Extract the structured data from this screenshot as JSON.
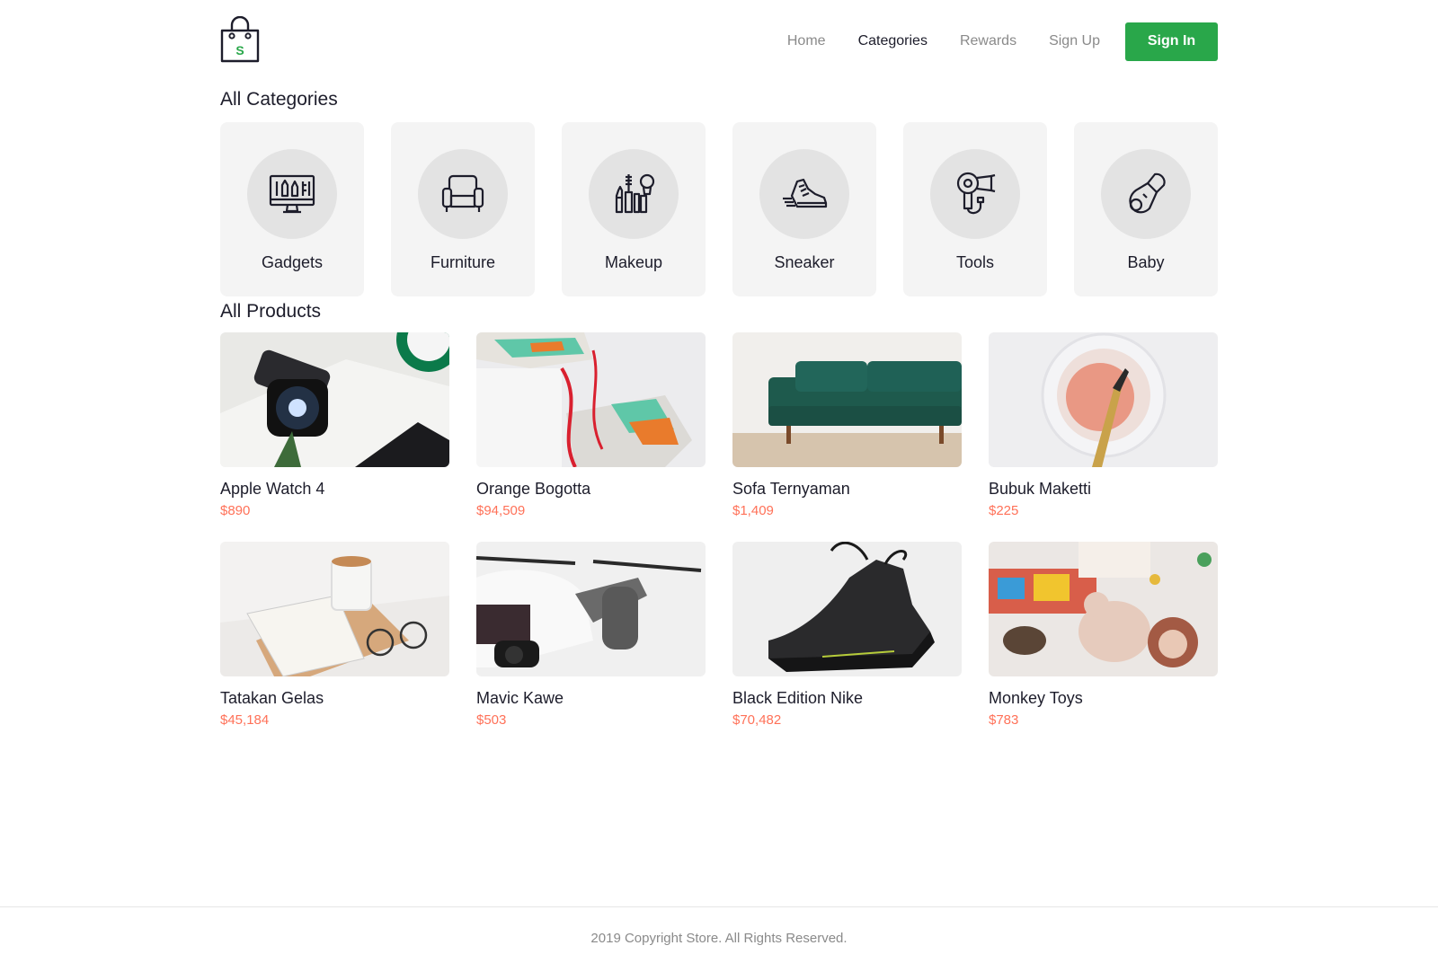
{
  "header": {
    "logo_letter": "S",
    "nav": [
      {
        "label": "Home"
      },
      {
        "label": "Categories"
      },
      {
        "label": "Rewards"
      },
      {
        "label": "Sign Up"
      }
    ],
    "signin_label": "Sign In"
  },
  "categories": {
    "title": "All Categories",
    "items": [
      {
        "label": "Gadgets",
        "icon": "monitor-icon"
      },
      {
        "label": "Furniture",
        "icon": "armchair-icon"
      },
      {
        "label": "Makeup",
        "icon": "makeup-icon"
      },
      {
        "label": "Sneaker",
        "icon": "sneaker-icon"
      },
      {
        "label": "Tools",
        "icon": "hair-dryer-icon"
      },
      {
        "label": "Baby",
        "icon": "pacifier-icon"
      }
    ]
  },
  "products": {
    "title": "All Products",
    "items": [
      {
        "name": "Apple Watch 4",
        "price": "$890"
      },
      {
        "name": "Orange Bogotta",
        "price": "$94,509"
      },
      {
        "name": "Sofa Ternyaman",
        "price": "$1,409"
      },
      {
        "name": "Bubuk Maketti",
        "price": "$225"
      },
      {
        "name": "Tatakan Gelas",
        "price": "$45,184"
      },
      {
        "name": "Mavic Kawe",
        "price": "$503"
      },
      {
        "name": "Black Edition Nike",
        "price": "$70,482"
      },
      {
        "name": "Monkey Toys",
        "price": "$783"
      }
    ]
  },
  "footer": {
    "copyright": "2019 Copyright Store. All Rights Reserved."
  },
  "colors": {
    "accent": "#29a74a",
    "price": "#ff7158",
    "card_bg": "#f4f4f4"
  }
}
